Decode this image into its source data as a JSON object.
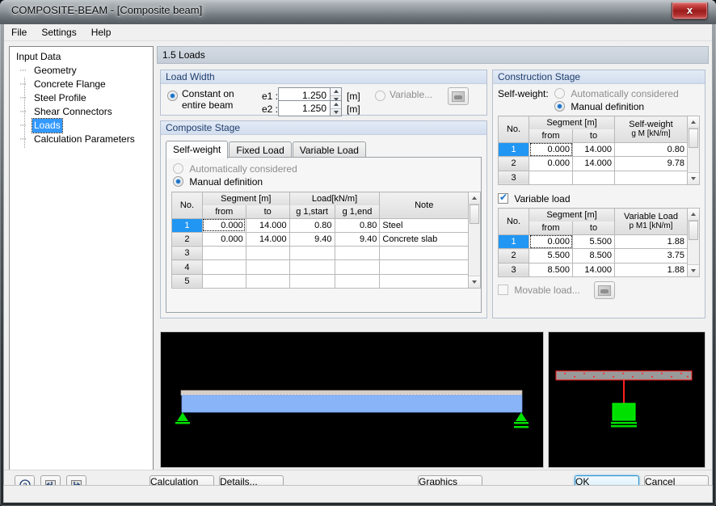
{
  "window": {
    "title": "COMPOSITE-BEAM - [Composite beam]",
    "close_label": "x"
  },
  "menubar": {
    "items": [
      {
        "label": "File"
      },
      {
        "label": "Settings"
      },
      {
        "label": "Help"
      }
    ]
  },
  "sidebar": {
    "root": "Input Data",
    "items": [
      {
        "label": "Geometry",
        "selected": false
      },
      {
        "label": "Concrete Flange",
        "selected": false
      },
      {
        "label": "Steel Profile",
        "selected": false
      },
      {
        "label": "Shear Connectors",
        "selected": false
      },
      {
        "label": "Loads",
        "selected": true
      },
      {
        "label": "Calculation Parameters",
        "selected": false
      }
    ]
  },
  "page": {
    "title": "1.5 Loads"
  },
  "load_width": {
    "title": "Load Width",
    "constant_label": "Constant on entire beam",
    "constant_selected": true,
    "e1_label": "e1 :",
    "e1_value": "1.250",
    "e1_unit": "[m]",
    "e2_label": "e2 :",
    "e2_value": "1.250",
    "e2_unit": "[m]",
    "variable_label": "Variable...",
    "variable_selected": false,
    "picker_icon": "table-picker-icon"
  },
  "composite_stage": {
    "title": "Composite Stage",
    "tabs": [
      {
        "label": "Self-weight",
        "active": true
      },
      {
        "label": "Fixed Load",
        "active": false
      },
      {
        "label": "Variable Load",
        "active": false
      }
    ],
    "auto_label": "Automatically considered",
    "auto_selected": false,
    "manual_label": "Manual definition",
    "manual_selected": true,
    "table": {
      "group_headers": [
        "No.",
        "Segment [m]",
        "Load[kN/m]",
        "Note"
      ],
      "sub_headers": [
        "from",
        "to",
        "g 1,start",
        "g 1,end"
      ],
      "rows": [
        {
          "no": "1",
          "from": "0.000",
          "to": "14.000",
          "start": "0.80",
          "end": "0.80",
          "note": "Steel",
          "selected": true
        },
        {
          "no": "2",
          "from": "0.000",
          "to": "14.000",
          "start": "9.40",
          "end": "9.40",
          "note": "Concrete slab",
          "selected": false
        },
        {
          "no": "3",
          "from": "",
          "to": "",
          "start": "",
          "end": "",
          "note": "",
          "selected": false
        },
        {
          "no": "4",
          "from": "",
          "to": "",
          "start": "",
          "end": "",
          "note": "",
          "selected": false
        },
        {
          "no": "5",
          "from": "",
          "to": "",
          "start": "",
          "end": "",
          "note": "",
          "selected": false
        }
      ]
    }
  },
  "construction_stage": {
    "title": "Construction Stage",
    "selfweight_label": "Self-weight:",
    "auto_label": "Automatically considered",
    "auto_selected": false,
    "manual_label": "Manual definition",
    "manual_selected": true,
    "sw_table": {
      "group_headers": [
        "No.",
        "Segment [m]",
        "Self-weight"
      ],
      "sub_headers": [
        "from",
        "to",
        "g M   [kN/m]"
      ],
      "rows": [
        {
          "no": "1",
          "from": "0.000",
          "to": "14.000",
          "value": "0.80",
          "selected": true
        },
        {
          "no": "2",
          "from": "0.000",
          "to": "14.000",
          "value": "9.78",
          "selected": false
        },
        {
          "no": "3",
          "from": "",
          "to": "",
          "value": "",
          "selected": false
        }
      ]
    },
    "variable_load_label": "Variable load",
    "variable_load_checked": true,
    "vl_table": {
      "group_headers": [
        "No.",
        "Segment [m]",
        "Variable Load"
      ],
      "sub_headers": [
        "from",
        "to",
        "p M1 [kN/m]"
      ],
      "rows": [
        {
          "no": "1",
          "from": "0.000",
          "to": "5.500",
          "value": "1.88",
          "selected": true
        },
        {
          "no": "2",
          "from": "5.500",
          "to": "8.500",
          "value": "3.75",
          "selected": false
        },
        {
          "no": "3",
          "from": "8.500",
          "to": "14.000",
          "value": "1.88",
          "selected": false
        }
      ]
    },
    "movable_label": "Movable load...",
    "movable_checked": false,
    "movable_icon": "table-picker-icon"
  },
  "graphics": {
    "side_view_name": "beam-side-view",
    "cross_section_name": "beam-cross-section"
  },
  "bottombar": {
    "help_icon": "help-question-icon",
    "prev_icon": "previous-arrow-icon",
    "next_icon": "next-arrow-icon",
    "calculation_label": "Calculation",
    "details_label": "Details...",
    "graphics_label": "Graphics",
    "ok_label": "OK",
    "cancel_label": "Cancel"
  },
  "colors": {
    "accent": "#3399ff",
    "selected_row": "#2196f3",
    "group_title_text": "#1f3e6e",
    "concrete": "#8ab4f8",
    "support_green": "#00d000",
    "steel_red": "#ff0000"
  }
}
